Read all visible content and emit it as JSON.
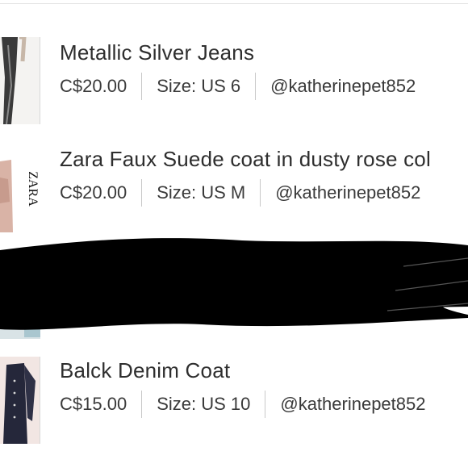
{
  "listings": [
    {
      "title": "Metallic Silver Jeans",
      "price": "C$20.00",
      "size": "Size: US 6",
      "seller": "@katherinepet852",
      "thumbnail": "metallic-jeans-photo"
    },
    {
      "title": "Zara Faux Suede coat in dusty rose col",
      "price": "C$20.00",
      "size": "Size: US M",
      "seller": "@katherinepet852",
      "thumbnail": "zara-coat-photo",
      "thumbnail_text": "ZARA"
    },
    {
      "redacted": true
    },
    {
      "title": "Balck Denim Coat",
      "price": "C$15.00",
      "size": "Size: US 10",
      "seller": "@katherinepet852",
      "thumbnail": "denim-coat-photo"
    }
  ],
  "colors": {
    "text": "#2b2b2b",
    "separator": "#c9c9c9",
    "redaction": "#000000"
  }
}
